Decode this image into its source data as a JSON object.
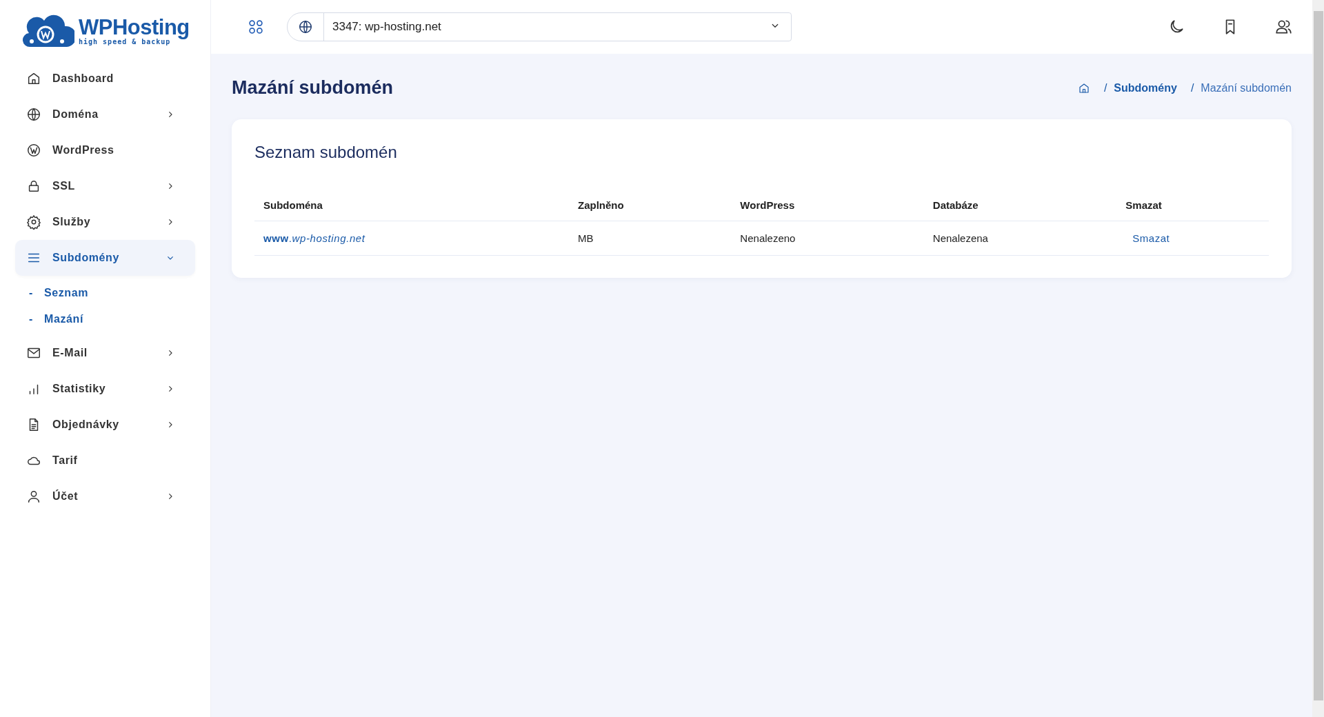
{
  "logo": {
    "name": "WPHosting",
    "tagline": "high speed & backup"
  },
  "sidebar": {
    "items": [
      {
        "label": "Dashboard",
        "expandable": false,
        "selected": false
      },
      {
        "label": "Doména",
        "expandable": true,
        "expanded": false,
        "selected": false
      },
      {
        "label": "WordPress",
        "expandable": false,
        "selected": false
      },
      {
        "label": "SSL",
        "expandable": true,
        "expanded": false,
        "selected": false
      },
      {
        "label": "Služby",
        "expandable": true,
        "expanded": false,
        "selected": false
      },
      {
        "label": "Subdomény",
        "expandable": true,
        "expanded": true,
        "selected": true,
        "children": [
          {
            "label": "Seznam",
            "bullet": "-"
          },
          {
            "label": "Mazání",
            "bullet": "-"
          }
        ]
      },
      {
        "label": "E-Mail",
        "expandable": true,
        "expanded": false,
        "selected": false
      },
      {
        "label": "Statistiky",
        "expandable": true,
        "expanded": false,
        "selected": false
      },
      {
        "label": "Objednávky",
        "expandable": true,
        "expanded": false,
        "selected": false
      },
      {
        "label": "Tarif",
        "expandable": false,
        "selected": false
      },
      {
        "label": "Účet",
        "expandable": true,
        "expanded": false,
        "selected": false
      }
    ]
  },
  "topbar": {
    "domain_select": {
      "value": "3347: wp-hosting.net"
    }
  },
  "page": {
    "title": "Mazání subdomén",
    "breadcrumb": [
      {
        "separator": "/",
        "label": "Subdomény",
        "kind": "link"
      },
      {
        "separator": "/",
        "label": "Mazání subdomén",
        "kind": "current"
      }
    ]
  },
  "card": {
    "title": "Seznam subdomén",
    "table": {
      "columns": [
        "Subdoména",
        "Zaplněno",
        "WordPress",
        "Databáze",
        "Smazat"
      ],
      "rows": [
        {
          "subdomain": "**www**.*wp-hosting.net*",
          "used": "MB",
          "wordpress": "Nenalezeno",
          "database": "Nenalezena",
          "action": "Smazat"
        }
      ]
    }
  }
}
